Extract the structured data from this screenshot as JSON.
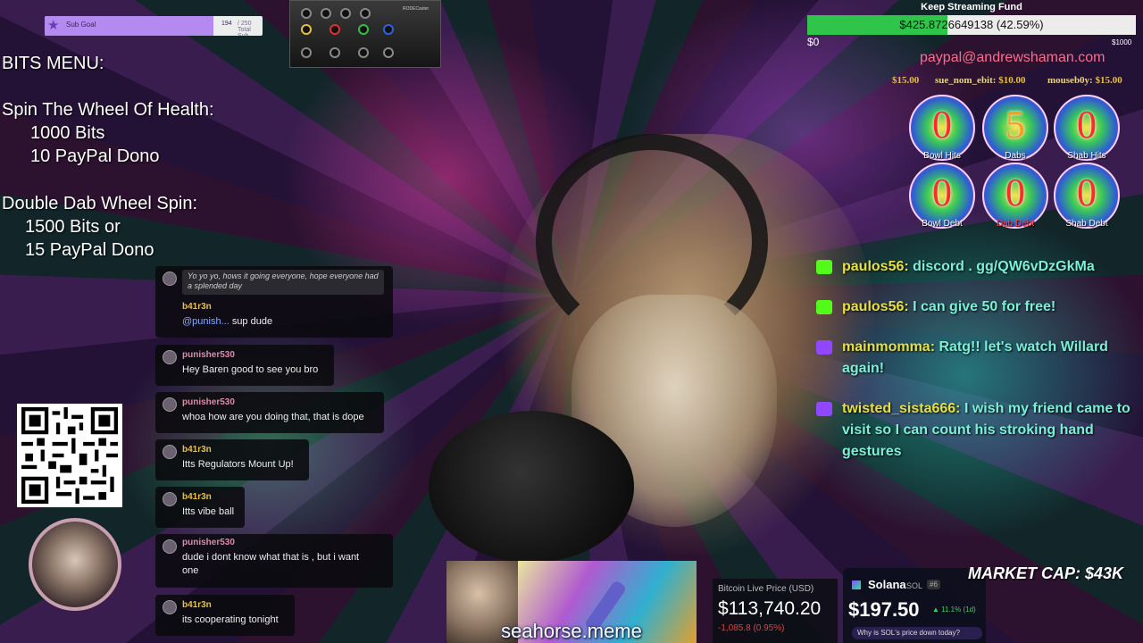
{
  "sub_goal": {
    "label": "Sub Goal",
    "count": "194",
    "total": "/ 250 Total Sub Points",
    "progress": 0.776
  },
  "mixer": {
    "brand": "RODECaster"
  },
  "bits_menu": {
    "title": "BITS MENU:",
    "wheel_health_title": "Spin The Wheel Of Health:",
    "wheel_health_bits": "1000 Bits",
    "wheel_health_paypal": "10 PayPal Dono",
    "double_dab_title": "Double Dab Wheel Spin:",
    "double_dab_bits": "1500 Bits or",
    "double_dab_paypal": "15 PayPal Dono"
  },
  "chat_left": {
    "welcome": "Yo yo yo, hows it going everyone, hope everyone had a splended day",
    "messages": [
      {
        "user": "b41r3n",
        "mention": "@punish...",
        "text": "sup dude"
      },
      {
        "user": "punisher530",
        "text": "Hey Baren good to see you bro"
      },
      {
        "user": "punisher530",
        "text": "whoa how are you doing that, that is dope"
      },
      {
        "user": "b41r3n",
        "text": "Itts Regulators Mount Up!"
      },
      {
        "user": "b41r3n",
        "text": "Itts vibe ball"
      },
      {
        "user": "punisher530",
        "text": "dude i dont know what that is , but i want",
        "text2": "one"
      },
      {
        "user": "b41r3n",
        "text": "its cooperating tonight"
      }
    ]
  },
  "fund": {
    "title": "Keep Streaming Fund",
    "value": "$425.8726649138 (42.59%)",
    "progress": 0.4259,
    "min": "$0",
    "max": "$1000",
    "paypal": "paypal@andrewshaman.com"
  },
  "donors": [
    {
      "amount": "$15.00"
    },
    {
      "name": "sue_nom_ebit:",
      "amount": "$10.00"
    },
    {
      "name": "mouseb0y:",
      "amount": "$15.00"
    }
  ],
  "counters": [
    {
      "value": "0",
      "label": "Bowl Hits"
    },
    {
      "value": "5",
      "label": "Dabs"
    },
    {
      "value": "0",
      "label": "Shab Hits"
    },
    {
      "value": "0",
      "label": "Bowl Debt"
    },
    {
      "value": "0",
      "label": "Dab Debt"
    },
    {
      "value": "0",
      "label": "Shab Debt"
    }
  ],
  "chat_right": [
    {
      "platform": "kick",
      "user": "paulos56:",
      "text": " discord . gg/QW6vDzGkMa"
    },
    {
      "platform": "kick",
      "user": "paulos56:",
      "text": " I can give 50 for free!"
    },
    {
      "platform": "twitch",
      "user": "mainmomma:",
      "text": " Ratg!! let's watch Willard again!"
    },
    {
      "platform": "twitch",
      "user": "twisted_sista666:",
      "text": " I wish my friend came to visit so I can count his stroking hand gestures"
    }
  ],
  "seahorse": {
    "text": "seahorse.meme"
  },
  "btc": {
    "label": "Bitcoin Live Price (USD)",
    "price": "$113,740.20",
    "change": "-1,085.8 (0.95%)"
  },
  "sol": {
    "name": "Solana",
    "ticker": "SOL",
    "rank": "#6",
    "price": "$197.50",
    "change": "▲ 11.1% (1d)",
    "question": "Why is SOL's price down today?"
  },
  "market_cap": "MARKET CAP: $43K",
  "colors": {
    "kick": "#53fc18",
    "twitch": "#9146ff",
    "fund_fill": "#2fc44a",
    "sub_goal_fill": "#b48af0"
  }
}
